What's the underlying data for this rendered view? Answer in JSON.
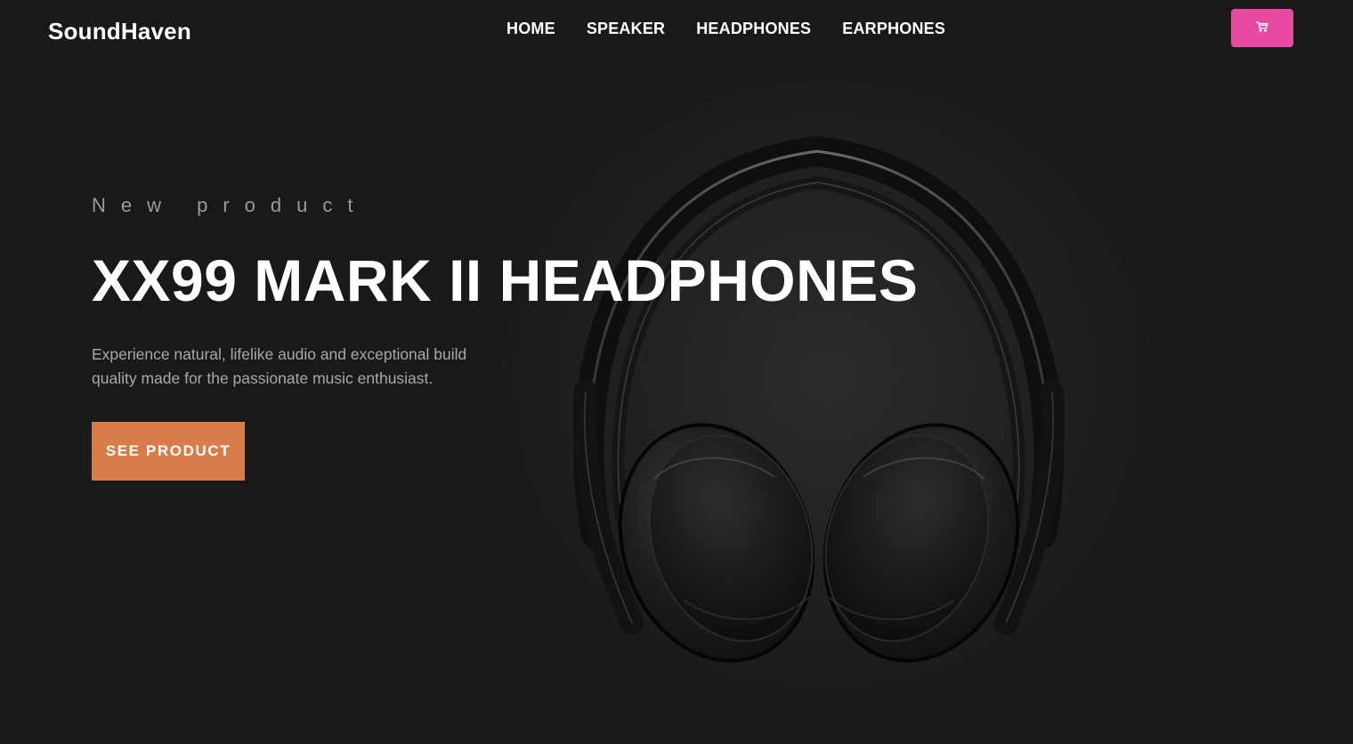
{
  "brand": {
    "name": "SoundHaven"
  },
  "nav": {
    "items": [
      {
        "label": "HOME"
      },
      {
        "label": "SPEAKER"
      },
      {
        "label": "HEADPHONES"
      },
      {
        "label": "EARPHONES"
      }
    ]
  },
  "cart": {
    "icon": "cart-icon",
    "color": "#e94aa1"
  },
  "hero": {
    "eyebrow": "New product",
    "title": "XX99 MARK II HEADPHONES",
    "description": "Experience natural, lifelike audio and exceptional build quality made for the passionate music enthusiast.",
    "cta_label": "SEE PRODUCT",
    "cta_color": "#d87d4a",
    "image": "headphones-image"
  },
  "colors": {
    "background": "#191919",
    "accent": "#d87d4a",
    "cart": "#e94aa1"
  }
}
